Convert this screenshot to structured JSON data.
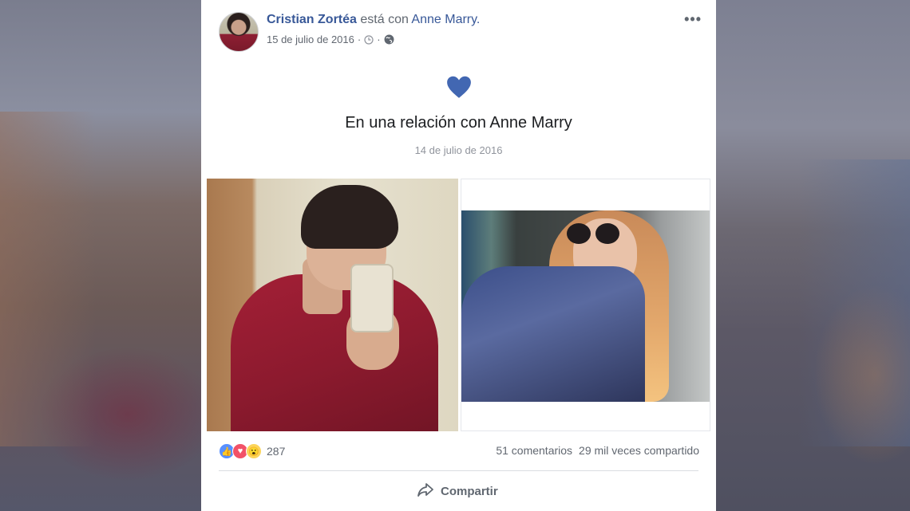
{
  "post": {
    "author": "Cristian Zortéa",
    "with_text": "está con",
    "tagged": "Anne Marry.",
    "date": "15 de julio de 2016",
    "separator": "·",
    "menu": "•••"
  },
  "relationship": {
    "title": "En una relación con Anne Marry",
    "date": "14 de julio de 2016",
    "heart_color": "#4267b2"
  },
  "footer": {
    "reaction_count": "287",
    "comments": "51 comentarios",
    "shares": "29 mil veces compartido",
    "share_button": "Compartir"
  },
  "icons": {
    "clock": "clock-icon",
    "globe": "globe-icon",
    "like": "like-icon",
    "love": "love-icon",
    "wow": "wow-icon",
    "share": "share-arrow-icon"
  }
}
